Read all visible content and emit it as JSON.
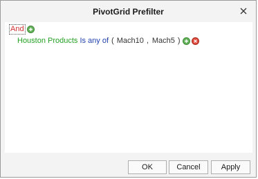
{
  "window": {
    "title": "PivotGrid Prefilter",
    "close_glyph": "✕"
  },
  "filter": {
    "group_operator": "And",
    "condition": {
      "field": "Houston Products",
      "operator": "Is any of",
      "open_paren": "(",
      "values": [
        "Mach10",
        "Mach5"
      ],
      "separator": ",",
      "close_paren": ")"
    }
  },
  "buttons": {
    "ok": "OK",
    "cancel": "Cancel",
    "apply": "Apply"
  },
  "colors": {
    "field": "#22a022",
    "operator": "#1f3fb0",
    "group_operator": "#d03030",
    "add_button": "#63b35a",
    "remove_button": "#e04a3c"
  },
  "icons": {
    "add": "plus-circle-icon",
    "remove": "x-circle-icon",
    "close": "close-icon"
  }
}
